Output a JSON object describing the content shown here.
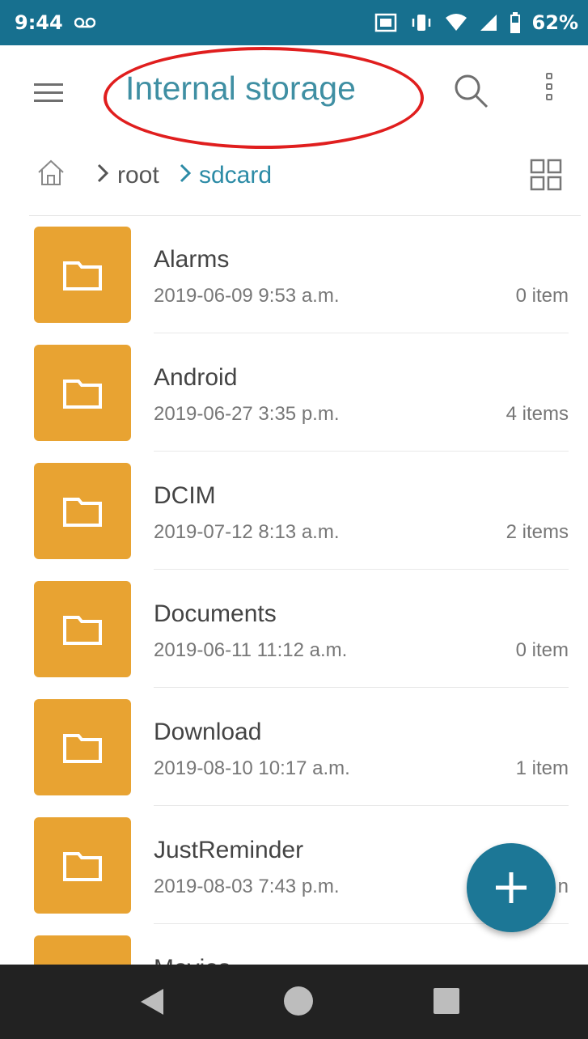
{
  "status_bar": {
    "time": "9:44",
    "battery": "62%",
    "icons": [
      "voicemail-icon",
      "cast-icon",
      "vibrate-icon",
      "wifi-icon",
      "signal-icon",
      "battery-icon"
    ]
  },
  "app_bar": {
    "title": "Internal storage",
    "icons": [
      "menu-icon",
      "search-icon",
      "more-vert-icon"
    ],
    "highlight_color": "#e01e1e"
  },
  "breadcrumb": {
    "items": [
      "root",
      "sdcard"
    ],
    "active_color": "#2c8ba6"
  },
  "folders": [
    {
      "name": "Alarms",
      "date": "2019-06-09 9:53 a.m.",
      "count": "0 item"
    },
    {
      "name": "Android",
      "date": "2019-06-27 3:35 p.m.",
      "count": "4 items"
    },
    {
      "name": "DCIM",
      "date": "2019-07-12 8:13 a.m.",
      "count": "2 items"
    },
    {
      "name": "Documents",
      "date": "2019-06-11 11:12 a.m.",
      "count": "0 item"
    },
    {
      "name": "Download",
      "date": "2019-08-10 10:17 a.m.",
      "count": "1 item"
    },
    {
      "name": "JustReminder",
      "date": "2019-08-03 7:43 p.m.",
      "count": "n"
    },
    {
      "name": "Movies",
      "date": "",
      "count": ""
    }
  ],
  "colors": {
    "status_bar": "#17708f",
    "folder": "#e8a332",
    "fab": "#1c7796",
    "nav_bar": "#222222"
  }
}
